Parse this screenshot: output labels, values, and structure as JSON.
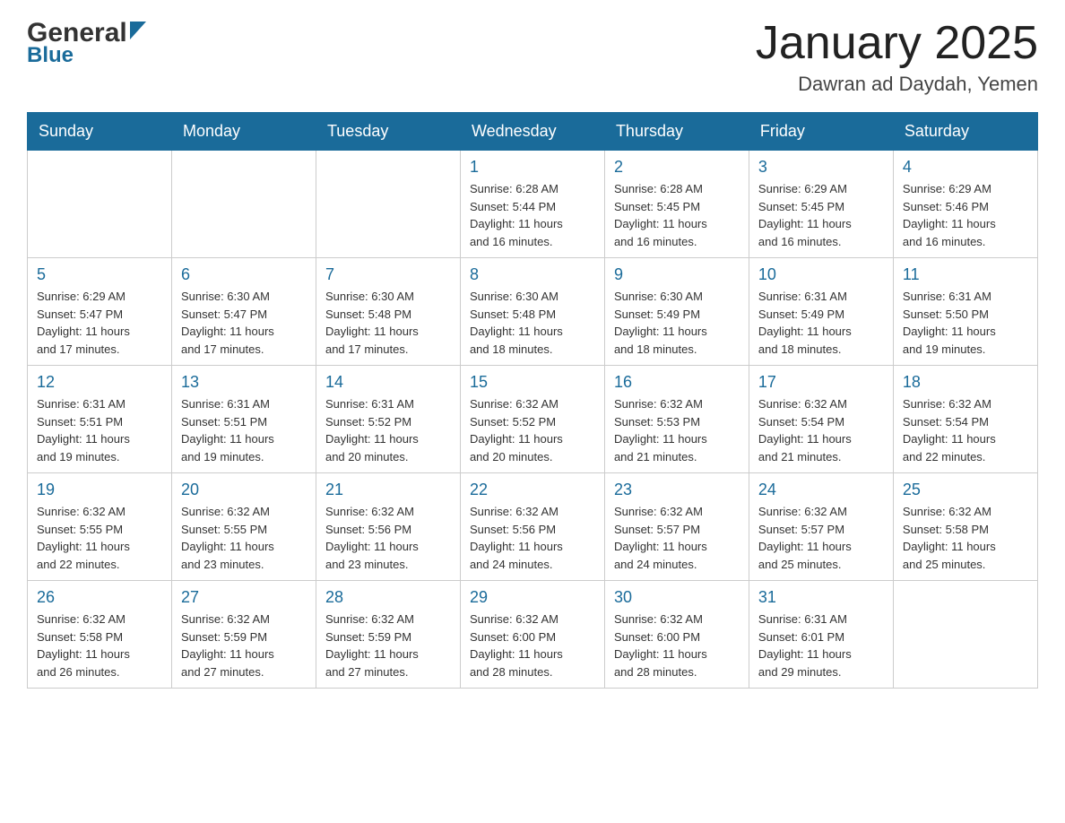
{
  "header": {
    "logo_general": "General",
    "logo_blue": "Blue",
    "month_title": "January 2025",
    "location": "Dawran ad Daydah, Yemen"
  },
  "days_of_week": [
    "Sunday",
    "Monday",
    "Tuesday",
    "Wednesday",
    "Thursday",
    "Friday",
    "Saturday"
  ],
  "weeks": [
    [
      {
        "day": "",
        "info": ""
      },
      {
        "day": "",
        "info": ""
      },
      {
        "day": "",
        "info": ""
      },
      {
        "day": "1",
        "info": "Sunrise: 6:28 AM\nSunset: 5:44 PM\nDaylight: 11 hours\nand 16 minutes."
      },
      {
        "day": "2",
        "info": "Sunrise: 6:28 AM\nSunset: 5:45 PM\nDaylight: 11 hours\nand 16 minutes."
      },
      {
        "day": "3",
        "info": "Sunrise: 6:29 AM\nSunset: 5:45 PM\nDaylight: 11 hours\nand 16 minutes."
      },
      {
        "day": "4",
        "info": "Sunrise: 6:29 AM\nSunset: 5:46 PM\nDaylight: 11 hours\nand 16 minutes."
      }
    ],
    [
      {
        "day": "5",
        "info": "Sunrise: 6:29 AM\nSunset: 5:47 PM\nDaylight: 11 hours\nand 17 minutes."
      },
      {
        "day": "6",
        "info": "Sunrise: 6:30 AM\nSunset: 5:47 PM\nDaylight: 11 hours\nand 17 minutes."
      },
      {
        "day": "7",
        "info": "Sunrise: 6:30 AM\nSunset: 5:48 PM\nDaylight: 11 hours\nand 17 minutes."
      },
      {
        "day": "8",
        "info": "Sunrise: 6:30 AM\nSunset: 5:48 PM\nDaylight: 11 hours\nand 18 minutes."
      },
      {
        "day": "9",
        "info": "Sunrise: 6:30 AM\nSunset: 5:49 PM\nDaylight: 11 hours\nand 18 minutes."
      },
      {
        "day": "10",
        "info": "Sunrise: 6:31 AM\nSunset: 5:49 PM\nDaylight: 11 hours\nand 18 minutes."
      },
      {
        "day": "11",
        "info": "Sunrise: 6:31 AM\nSunset: 5:50 PM\nDaylight: 11 hours\nand 19 minutes."
      }
    ],
    [
      {
        "day": "12",
        "info": "Sunrise: 6:31 AM\nSunset: 5:51 PM\nDaylight: 11 hours\nand 19 minutes."
      },
      {
        "day": "13",
        "info": "Sunrise: 6:31 AM\nSunset: 5:51 PM\nDaylight: 11 hours\nand 19 minutes."
      },
      {
        "day": "14",
        "info": "Sunrise: 6:31 AM\nSunset: 5:52 PM\nDaylight: 11 hours\nand 20 minutes."
      },
      {
        "day": "15",
        "info": "Sunrise: 6:32 AM\nSunset: 5:52 PM\nDaylight: 11 hours\nand 20 minutes."
      },
      {
        "day": "16",
        "info": "Sunrise: 6:32 AM\nSunset: 5:53 PM\nDaylight: 11 hours\nand 21 minutes."
      },
      {
        "day": "17",
        "info": "Sunrise: 6:32 AM\nSunset: 5:54 PM\nDaylight: 11 hours\nand 21 minutes."
      },
      {
        "day": "18",
        "info": "Sunrise: 6:32 AM\nSunset: 5:54 PM\nDaylight: 11 hours\nand 22 minutes."
      }
    ],
    [
      {
        "day": "19",
        "info": "Sunrise: 6:32 AM\nSunset: 5:55 PM\nDaylight: 11 hours\nand 22 minutes."
      },
      {
        "day": "20",
        "info": "Sunrise: 6:32 AM\nSunset: 5:55 PM\nDaylight: 11 hours\nand 23 minutes."
      },
      {
        "day": "21",
        "info": "Sunrise: 6:32 AM\nSunset: 5:56 PM\nDaylight: 11 hours\nand 23 minutes."
      },
      {
        "day": "22",
        "info": "Sunrise: 6:32 AM\nSunset: 5:56 PM\nDaylight: 11 hours\nand 24 minutes."
      },
      {
        "day": "23",
        "info": "Sunrise: 6:32 AM\nSunset: 5:57 PM\nDaylight: 11 hours\nand 24 minutes."
      },
      {
        "day": "24",
        "info": "Sunrise: 6:32 AM\nSunset: 5:57 PM\nDaylight: 11 hours\nand 25 minutes."
      },
      {
        "day": "25",
        "info": "Sunrise: 6:32 AM\nSunset: 5:58 PM\nDaylight: 11 hours\nand 25 minutes."
      }
    ],
    [
      {
        "day": "26",
        "info": "Sunrise: 6:32 AM\nSunset: 5:58 PM\nDaylight: 11 hours\nand 26 minutes."
      },
      {
        "day": "27",
        "info": "Sunrise: 6:32 AM\nSunset: 5:59 PM\nDaylight: 11 hours\nand 27 minutes."
      },
      {
        "day": "28",
        "info": "Sunrise: 6:32 AM\nSunset: 5:59 PM\nDaylight: 11 hours\nand 27 minutes."
      },
      {
        "day": "29",
        "info": "Sunrise: 6:32 AM\nSunset: 6:00 PM\nDaylight: 11 hours\nand 28 minutes."
      },
      {
        "day": "30",
        "info": "Sunrise: 6:32 AM\nSunset: 6:00 PM\nDaylight: 11 hours\nand 28 minutes."
      },
      {
        "day": "31",
        "info": "Sunrise: 6:31 AM\nSunset: 6:01 PM\nDaylight: 11 hours\nand 29 minutes."
      },
      {
        "day": "",
        "info": ""
      }
    ]
  ]
}
